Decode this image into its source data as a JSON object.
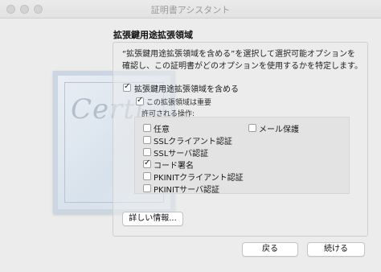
{
  "window": {
    "title": "証明書アシスタント"
  },
  "section": {
    "title": "拡張鍵用途拡張領域"
  },
  "description": "“拡張鍵用途拡張領域を含める”を選択して選択可能オプションを確認し、この証明書がどのオプションを使用するかを特定します。",
  "include": {
    "label": "拡張鍵用途拡張領域を含める",
    "checked": true
  },
  "critical": {
    "label": "この拡張領域は重要",
    "checked": true
  },
  "allowed_ops_label": "許可される操作:",
  "options": [
    {
      "label": "任意",
      "checked": false
    },
    {
      "label": "SSLクライアント認証",
      "checked": false
    },
    {
      "label": "SSLサーバ認証",
      "checked": false
    },
    {
      "label": "コード署名",
      "checked": true
    },
    {
      "label": "PKINITクライアント認証",
      "checked": false
    },
    {
      "label": "PKINITサーバ認証",
      "checked": false
    }
  ],
  "option_right": {
    "label": "メール保護",
    "checked": false
  },
  "buttons": {
    "details": "詳しい情報...",
    "back": "戻る",
    "continue": "続ける"
  },
  "checkmark_glyph": "✓",
  "icons": [
    "close-icon",
    "minimize-icon",
    "zoom-icon",
    "certificate-image"
  ]
}
